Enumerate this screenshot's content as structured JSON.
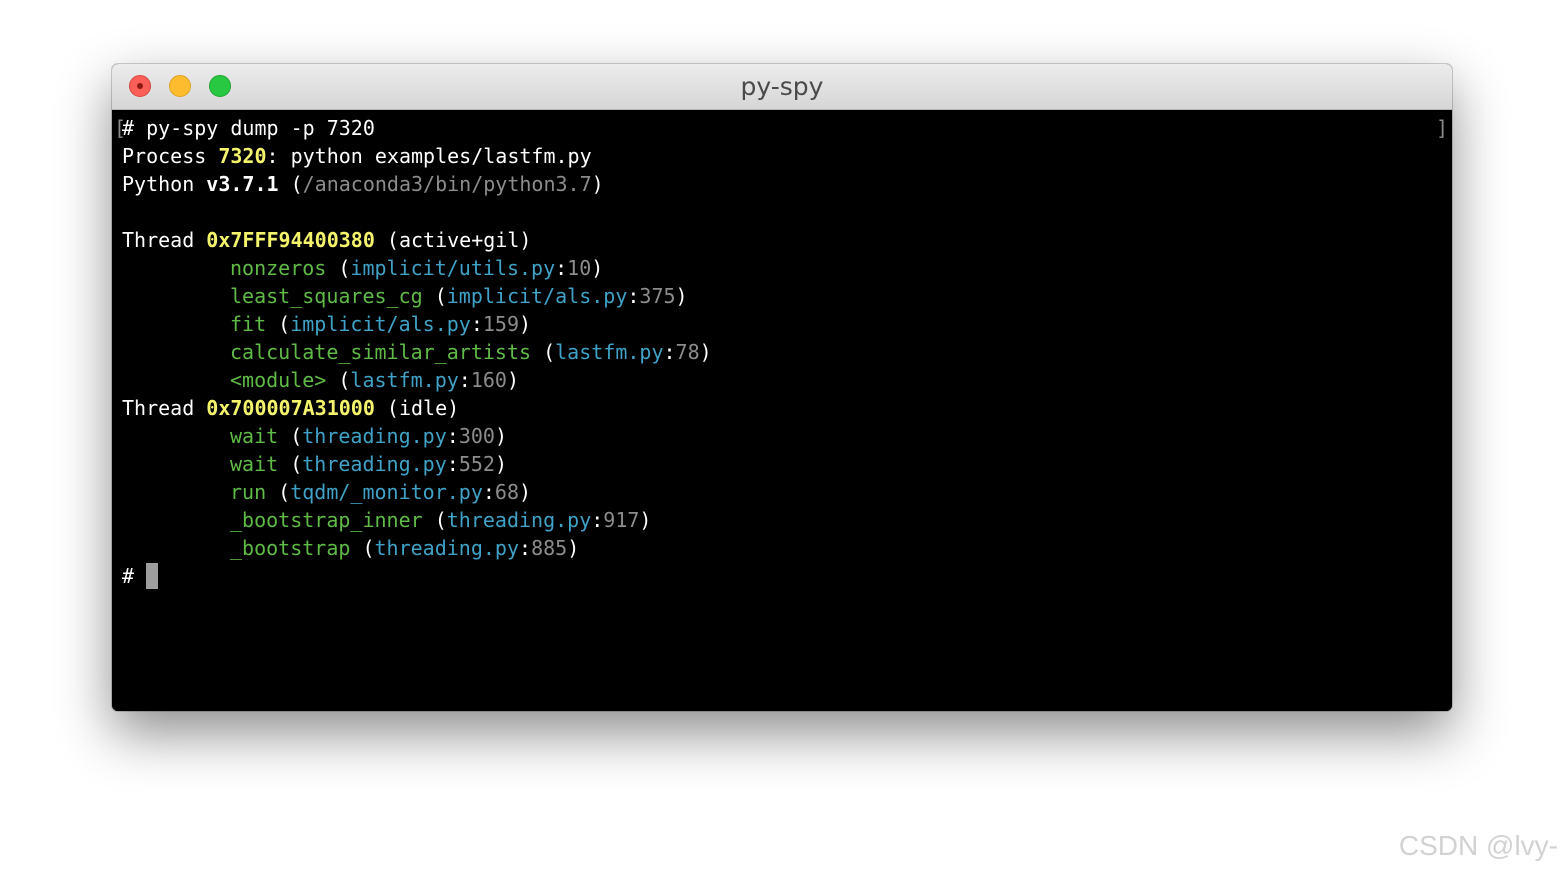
{
  "window": {
    "title": "py-spy"
  },
  "terminal": {
    "command_prompt": "# ",
    "command": "py-spy dump -p 7320",
    "process_label": "Process ",
    "pid": "7320",
    "process_cmd": ": python examples/lastfm.py",
    "python_label": "Python ",
    "python_version": "v3.7.1",
    "python_path_open": " (",
    "python_path": "/anaconda3/bin/python3.7",
    "python_path_close": ")",
    "threads": [
      {
        "label": "Thread ",
        "id": "0x7FFF94400380",
        "state": " (active+gil)",
        "frames": [
          {
            "func": "nonzeros",
            "file": "implicit/utils.py",
            "line": "10"
          },
          {
            "func": "least_squares_cg",
            "file": "implicit/als.py",
            "line": "375"
          },
          {
            "func": "fit",
            "file": "implicit/als.py",
            "line": "159"
          },
          {
            "func": "calculate_similar_artists",
            "file": "lastfm.py",
            "line": "78"
          },
          {
            "func": "<module>",
            "file": "lastfm.py",
            "line": "160"
          }
        ]
      },
      {
        "label": "Thread ",
        "id": "0x700007A31000",
        "state": " (idle)",
        "frames": [
          {
            "func": "wait",
            "file": "threading.py",
            "line": "300"
          },
          {
            "func": "wait",
            "file": "threading.py",
            "line": "552"
          },
          {
            "func": "run",
            "file": "tqdm/_monitor.py",
            "line": "68"
          },
          {
            "func": "_bootstrap_inner",
            "file": "threading.py",
            "line": "917"
          },
          {
            "func": "_bootstrap",
            "file": "threading.py",
            "line": "885"
          }
        ]
      }
    ],
    "final_prompt": "#"
  },
  "watermark": "CSDN @lvy-",
  "colors": {
    "pid_thread_id": "#f4f36b",
    "function": "#5fba46",
    "file": "#3fa2c6",
    "line_number": "#8c8c8c",
    "background": "#000000"
  }
}
